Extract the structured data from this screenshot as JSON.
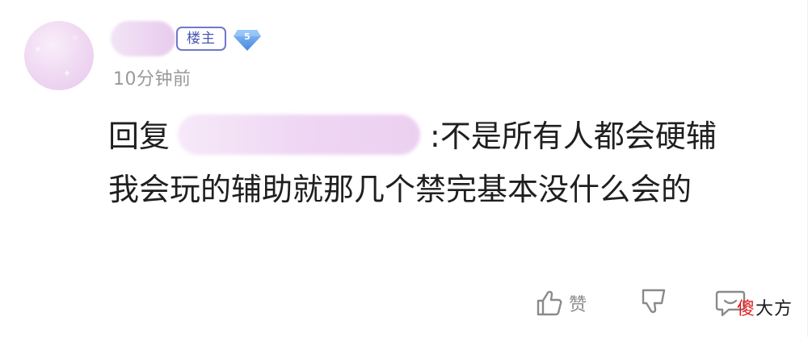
{
  "comment": {
    "owner_badge": "楼主",
    "level": "5",
    "timestamp": "10分钟前",
    "reply_prefix": "回复",
    "body": ":不是所有人都会硬辅 我会玩的辅助就那几个禁完基本没什么会的"
  },
  "actions": {
    "like_label": "赞"
  },
  "watermark": {
    "red_char": "傻",
    "rest": "大方"
  },
  "colors": {
    "badge_border": "#6f79c7",
    "level_badge": "#5b9be8",
    "timestamp": "#999999",
    "text": "#1f1f1f",
    "icon": "#8a8a8a",
    "watermark_red": "#e02020"
  }
}
